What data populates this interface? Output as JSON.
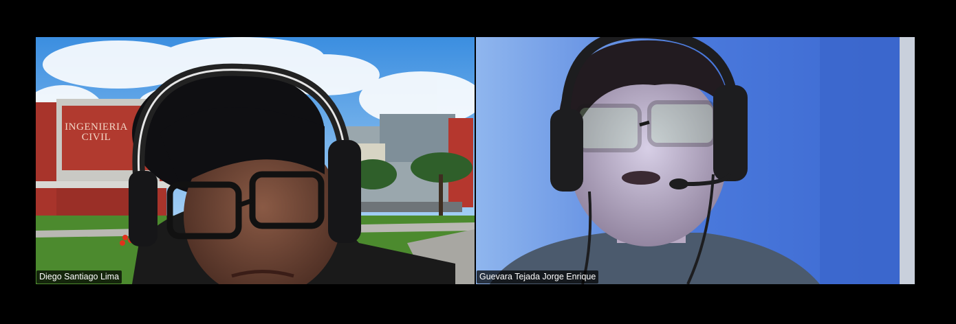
{
  "participants": [
    {
      "name": "Diego Santiago Lima",
      "background_sign": [
        "INGENIERIA",
        "CIVIL"
      ]
    },
    {
      "name": "Guevara Tejada Jorge Enrique"
    }
  ],
  "colors": {
    "sky": "#5fa8e8",
    "building_red": "#b5352c",
    "grass": "#4c8a2e",
    "wall_blue": "#3f74d9"
  }
}
